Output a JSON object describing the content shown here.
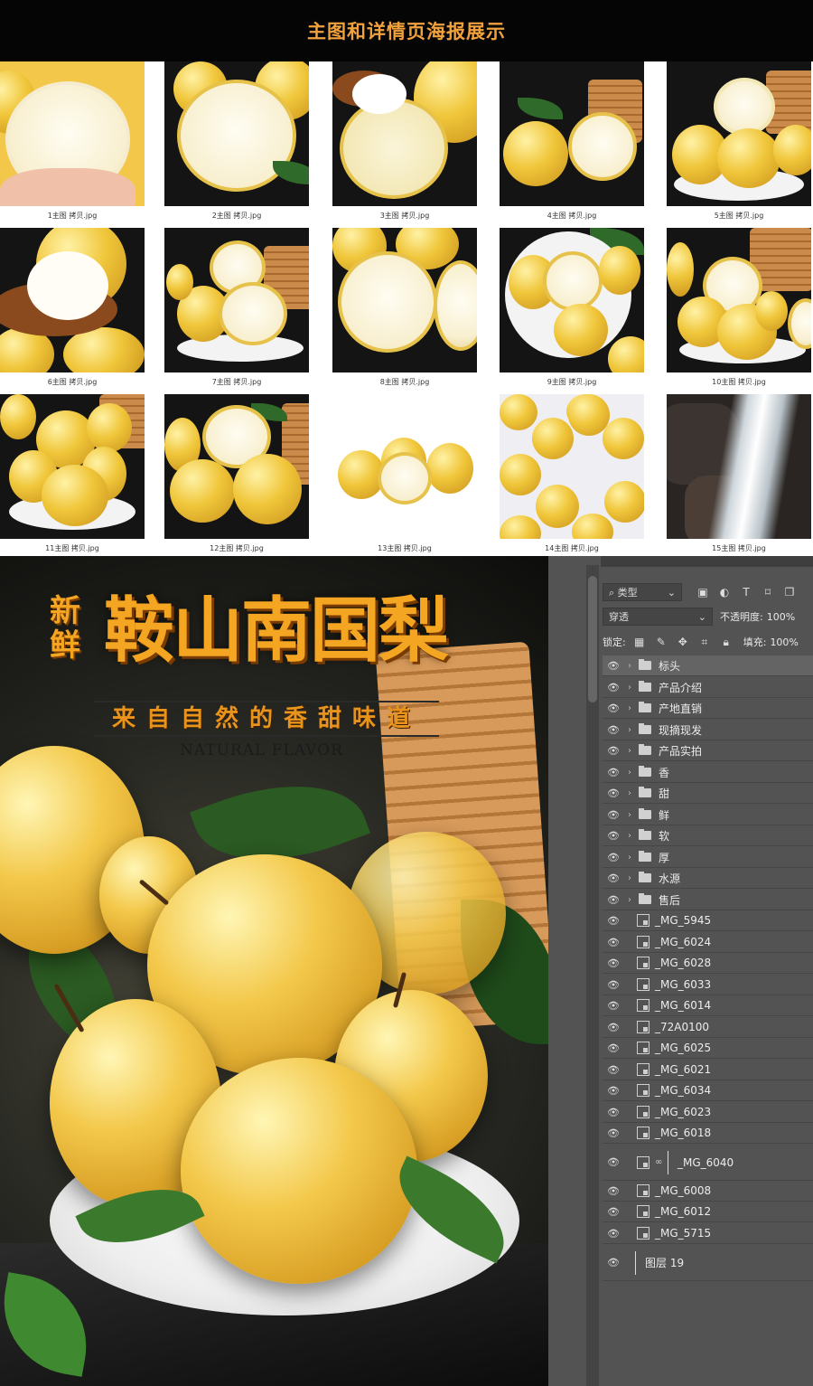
{
  "header": {
    "title": "主图和详情页海报展示"
  },
  "thumbnails": [
    {
      "caption": "1主图 拷贝.jpg"
    },
    {
      "caption": "2主图 拷贝.jpg"
    },
    {
      "caption": "3主图 拷贝.jpg"
    },
    {
      "caption": "4主图 拷贝.jpg"
    },
    {
      "caption": "5主图 拷贝.jpg"
    },
    {
      "caption": "6主图 拷贝.jpg"
    },
    {
      "caption": "7主图 拷贝.jpg"
    },
    {
      "caption": "8主图 拷贝.jpg"
    },
    {
      "caption": "9主图 拷贝.jpg"
    },
    {
      "caption": "10主图 拷贝.jpg"
    },
    {
      "caption": "11主图 拷贝.jpg"
    },
    {
      "caption": "12主图 拷贝.jpg"
    },
    {
      "caption": "13主图 拷贝.jpg"
    },
    {
      "caption": "14主图 拷贝.jpg"
    },
    {
      "caption": "15主图 拷贝.jpg"
    }
  ],
  "poster": {
    "title_small": "新鲜",
    "title_big": "鞍山南国梨",
    "slogan": "来自自然的香甜味道",
    "english": "NATURAL FLAVOR"
  },
  "layers_panel": {
    "filter_label": "类型",
    "blend_mode": "穿透",
    "opacity_label": "不透明度:",
    "opacity_value": "100%",
    "lock_label": "锁定:",
    "fill_label": "填充:",
    "fill_value": "100%",
    "groups": [
      "标头",
      "产品介绍",
      "产地直销",
      "现摘现发",
      "产品实拍",
      "香",
      "甜",
      "鲜",
      "软",
      "厚",
      "水源",
      "售后"
    ],
    "smart_layers": [
      "_MG_5945",
      "_MG_6024",
      "_MG_6028",
      "_MG_6033",
      "_MG_6014",
      "_72A0100",
      "_MG_6025",
      "_MG_6021",
      "_MG_6034",
      "_MG_6023",
      "_MG_6018"
    ],
    "linked_layer": "_MG_6040",
    "bottom_layers": [
      "_MG_6008",
      "_MG_6012",
      "_MG_5715"
    ],
    "last_layer": "图层 19"
  }
}
